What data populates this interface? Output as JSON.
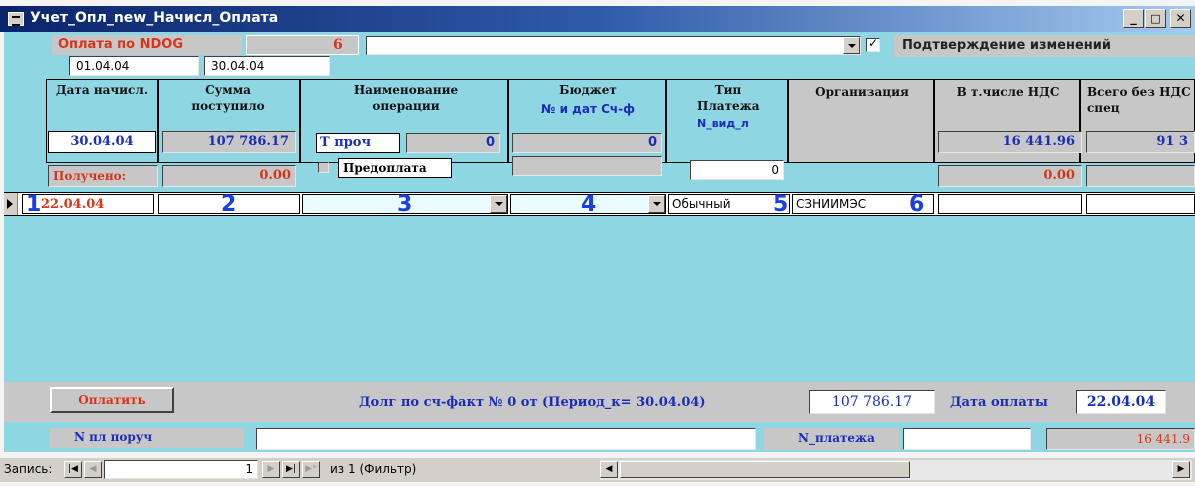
{
  "window": {
    "title": "Учет_Опл_new_Начисл_Оплата",
    "min": "_",
    "max": "□",
    "close": "✕"
  },
  "header": {
    "ndog_label": "Оплата по NDOG",
    "ndog_value": "",
    "ndog_number": "6",
    "date_from": "01.04.04",
    "date_to": "30.04.04",
    "confirm_label": "Подтверждение изменений",
    "confirm_checked": true
  },
  "columns": {
    "date": "Дата начисл.",
    "sum": "Сумма поступило",
    "opname": "Наименование операции",
    "budget": "Бюджет",
    "budget_sub": "№ и дат Сч-ф",
    "paytype": "Тип Платежа",
    "paytype_sub": "N_вид_л",
    "org": "Организация",
    "vat": "В т.числе НДС",
    "total": "Всего без НДС и спец"
  },
  "summary": {
    "date": "30.04.04",
    "sum": "107 786.17",
    "received_label": "Получено:",
    "received": "0.00",
    "op_code": "Т проч",
    "op_num": "0",
    "prepay_label": "Предоплата",
    "budget_num": "0",
    "paytype_num": "0",
    "vat": "16 441.96",
    "vat2": "0.00",
    "total": "91 3"
  },
  "row": {
    "date": "22.04.04",
    "paytype": "Обычный",
    "org": "СЗНИИМЭС",
    "n1": "1",
    "n2": "2",
    "n3": "3",
    "n4": "4",
    "n5": "5",
    "n6": "6"
  },
  "footer": {
    "pay_button": "Оплатить",
    "debt_text": "Долг по сч-факт № 0 от  (Период_к=  30.04.04)",
    "debt_value": "107 786.17",
    "pay_date_label": "Дата оплаты",
    "pay_date": "22.04.04",
    "order_label": "N пл поруч",
    "payment_label": "N_платежа",
    "payment_value": "",
    "remain": "16 441.9"
  },
  "status": {
    "record_label": "Запись:",
    "record_num": "1",
    "of_text": "из 1 (Фильтр)"
  }
}
